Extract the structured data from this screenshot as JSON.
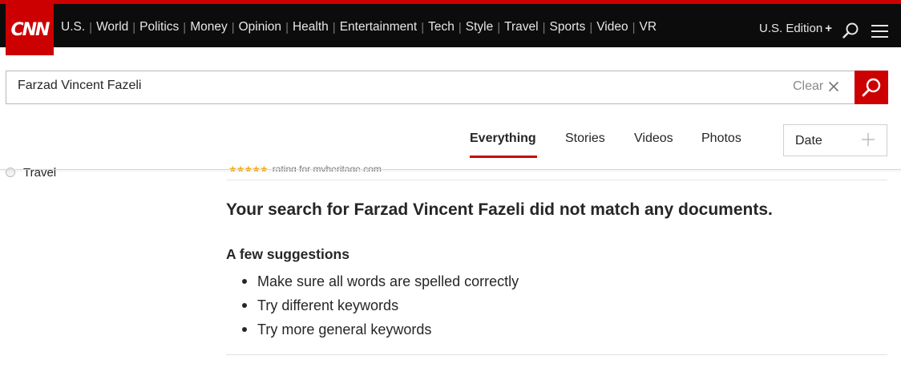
{
  "header": {
    "logo_text": "CNN",
    "nav": [
      "U.S.",
      "World",
      "Politics",
      "Money",
      "Opinion",
      "Health",
      "Entertainment",
      "Tech",
      "Style",
      "Travel",
      "Sports",
      "Video",
      "VR"
    ],
    "edition_label": "U.S. Edition",
    "edition_plus": "+",
    "icons": {
      "search": "search-icon",
      "menu": "hamburger-menu-icon"
    }
  },
  "search": {
    "value": "Farzad Vincent Fazeli",
    "clear_label": "Clear",
    "icons": {
      "clear": "close-icon",
      "submit": "search-icon"
    }
  },
  "tabs": {
    "items": [
      "Everything",
      "Stories",
      "Videos",
      "Photos"
    ],
    "active": "Everything"
  },
  "sort": {
    "label": "Date",
    "icon": "plus-icon"
  },
  "filters": {
    "partial_item": "Travel"
  },
  "previous_result": {
    "stars": "★★★★★",
    "text": "rating for myheritage.com"
  },
  "results": {
    "no_match": "Your search for Farzad Vincent Fazeli did not match any documents.",
    "suggestions_title": "A few suggestions",
    "suggestions": [
      "Make sure all words are spelled correctly",
      "Try different keywords",
      "Try more general keywords"
    ]
  },
  "colors": {
    "brand_red": "#cc0000",
    "topbar": "#0c0c0c",
    "text": "#262626"
  }
}
